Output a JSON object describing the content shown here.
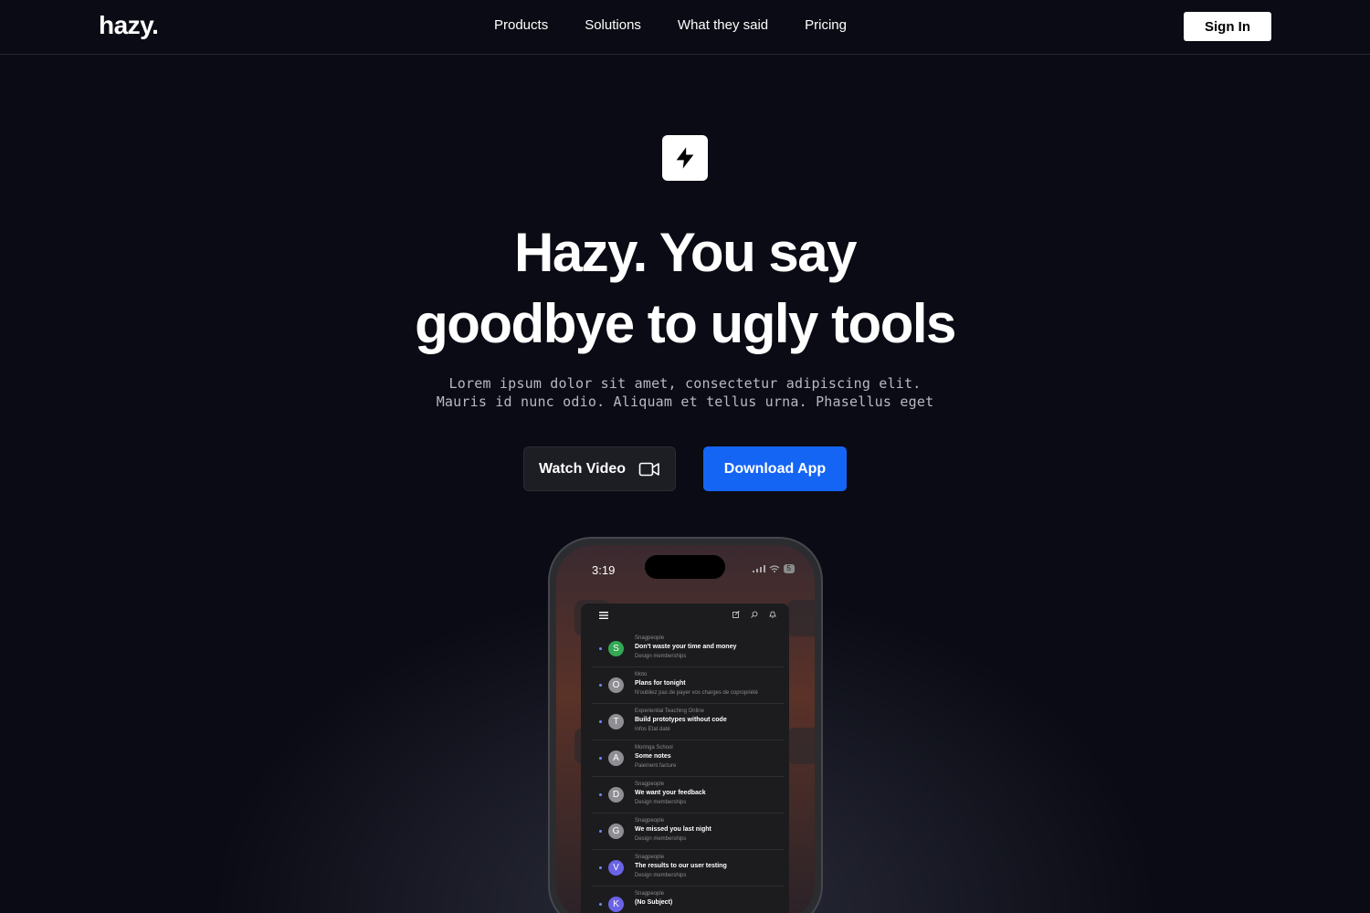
{
  "brand": {
    "logo": "hazy."
  },
  "nav": {
    "links": [
      "Products",
      "Solutions",
      "What they said",
      "Pricing"
    ],
    "signin_label": "Sign In"
  },
  "hero": {
    "icon": "lightning-bolt-icon",
    "headline_line1": "Hazy. You say",
    "headline_line2": "goodbye to ugly tools",
    "sub_line1": "Lorem ipsum dolor sit amet, consectetur adipiscing elit.",
    "sub_line2": "Mauris id nunc odio. Aliquam et tellus urna. Phasellus eget",
    "watch_label": "Watch Video",
    "watch_icon": "video-camera-icon",
    "download_label": "Download App"
  },
  "phone": {
    "time": "3:19",
    "battery": "5",
    "mails": [
      {
        "initial": "S",
        "color": "#34a853",
        "from": "Snagpeople",
        "subject": "Don't waste your time and money",
        "preview": "Design memberships"
      },
      {
        "initial": "O",
        "color": "#8e8e93",
        "from": "Moto",
        "subject": "Plans for tonight",
        "preview": "N'oubliez pas de payer vos charges de copropriété"
      },
      {
        "initial": "T",
        "color": "#8e8e93",
        "from": "Experiential Teaching Online",
        "subject": "Build prototypes without code",
        "preview": "Infos Etat daté"
      },
      {
        "initial": "A",
        "color": "#8e8e93",
        "from": "Moringa School",
        "subject": "Some notes",
        "preview": "Paiement facture"
      },
      {
        "initial": "D",
        "color": "#8e8e93",
        "from": "Snagpeople",
        "subject": "We want your feedback",
        "preview": "Design memberships"
      },
      {
        "initial": "G",
        "color": "#8e8e93",
        "from": "Snagpeople",
        "subject": "We missed you last night",
        "preview": "Design memberships"
      },
      {
        "initial": "V",
        "color": "#6b63e6",
        "from": "Snagpeople",
        "subject": "The results to our user testing",
        "preview": "Design memberships"
      },
      {
        "initial": "K",
        "color": "#6b63e6",
        "from": "Snagpeople",
        "subject": "(No Subject)",
        "preview": ""
      }
    ]
  },
  "colors": {
    "background": "#0a0b14",
    "accent": "#1565f5",
    "button_dark": "#1d1e24"
  }
}
